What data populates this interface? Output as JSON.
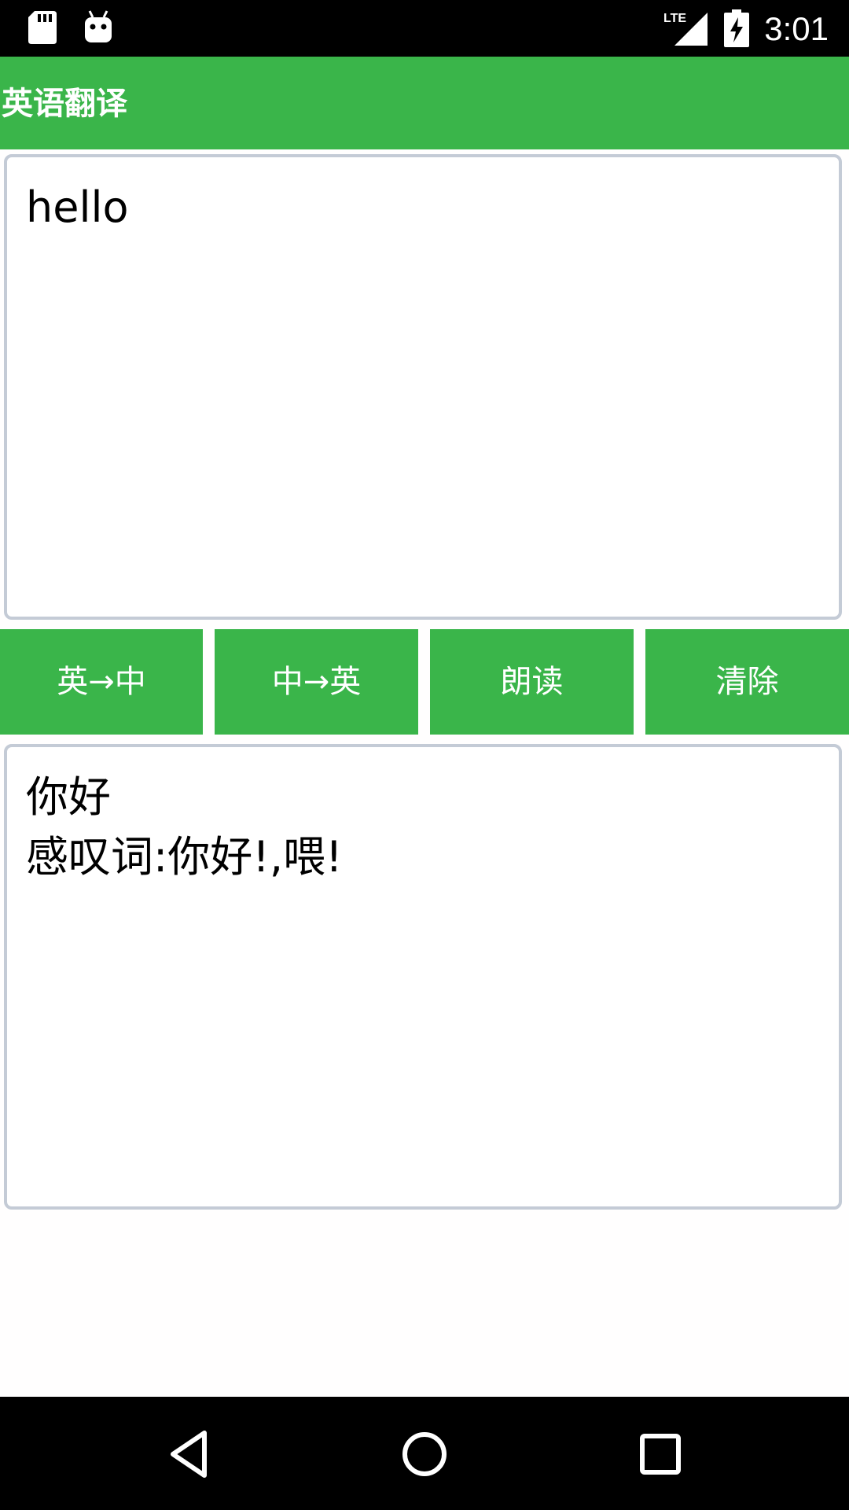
{
  "status_bar": {
    "time": "3:01",
    "icons": [
      "sd-card-icon",
      "android-debug-icon",
      "lte-signal-icon",
      "battery-charging-icon"
    ],
    "network_label": "LTE"
  },
  "app_bar": {
    "title": "英语翻译",
    "color": "#3ab54a"
  },
  "input": {
    "value": "hello"
  },
  "buttons": {
    "en_to_zh": "英→中",
    "zh_to_en": "中→英",
    "read_aloud": "朗读",
    "clear": "清除"
  },
  "output": {
    "value": "你好\n感叹词:你好!,喂!"
  },
  "nav_bar": {
    "icons": [
      "back-icon",
      "home-icon",
      "recents-icon"
    ]
  }
}
